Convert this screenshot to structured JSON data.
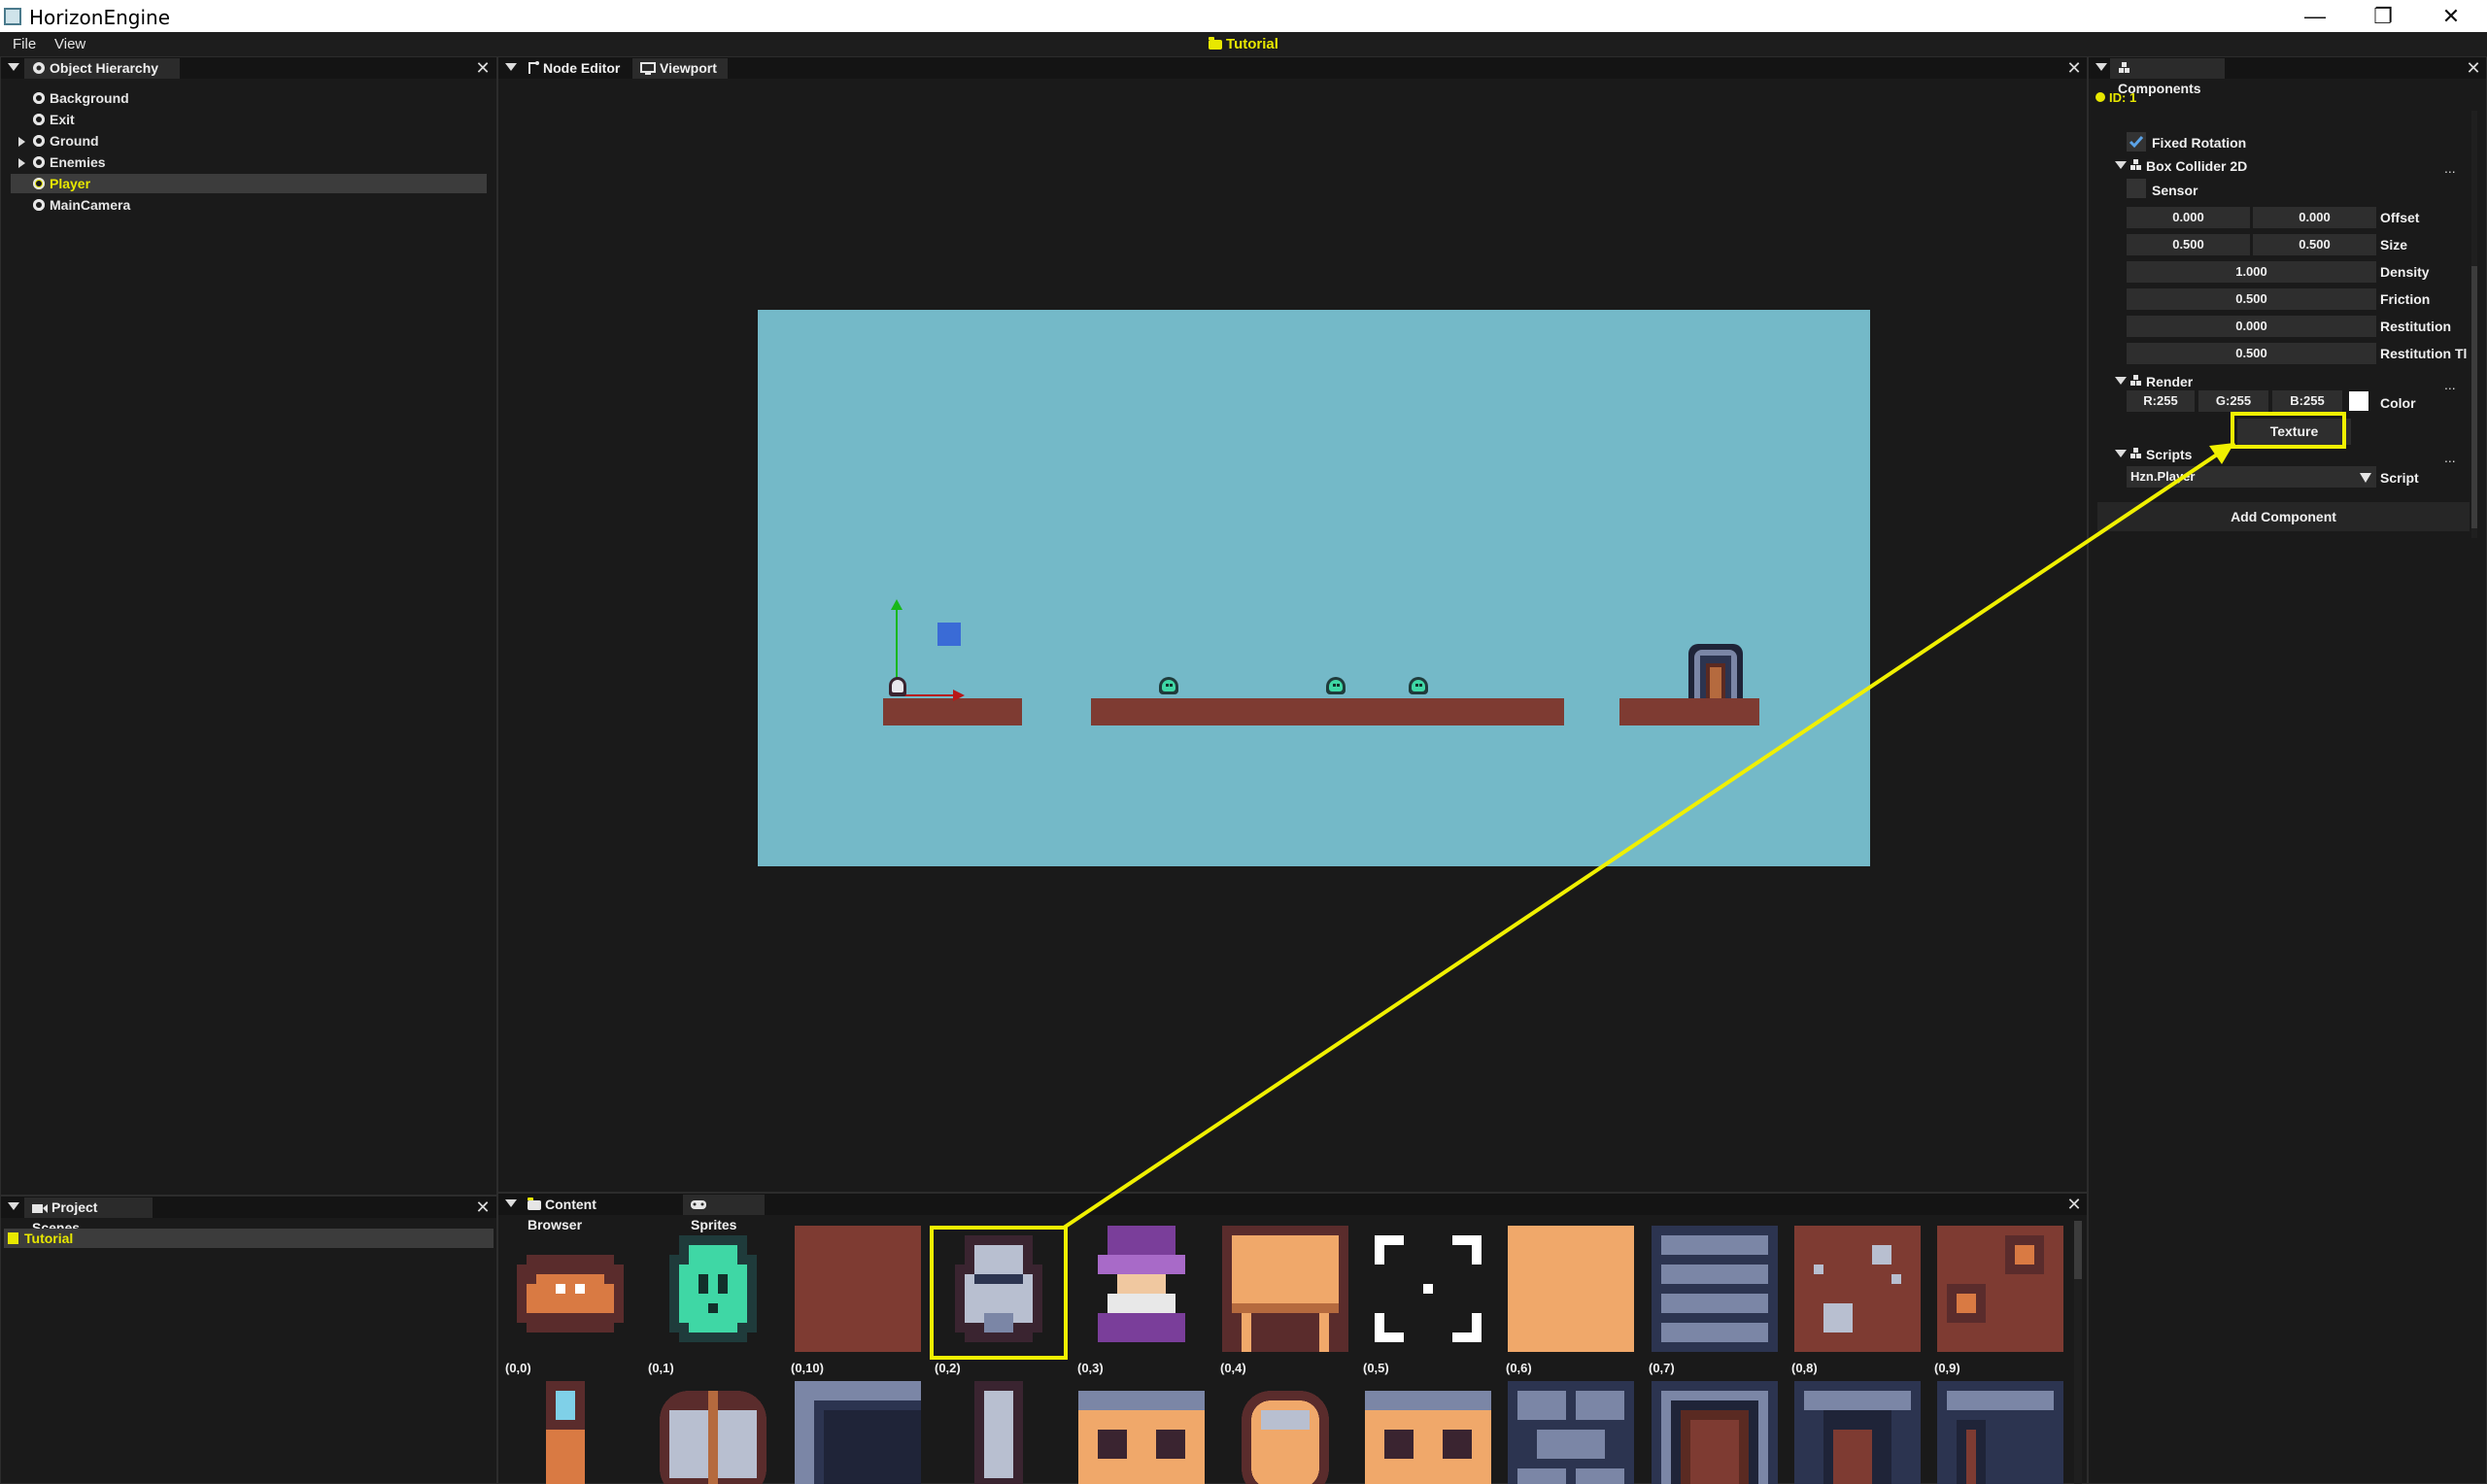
{
  "window": {
    "title": "HorizonEngine",
    "minimize": "—",
    "restore": "❐",
    "close": "✕"
  },
  "menubar": {
    "items": [
      "File",
      "View"
    ],
    "scene_title": "Tutorial"
  },
  "hierarchy": {
    "tab_label": "Object Hierarchy",
    "items": [
      {
        "label": "Background",
        "expandable": false,
        "selected": false
      },
      {
        "label": "Exit",
        "expandable": false,
        "selected": false
      },
      {
        "label": "Ground",
        "expandable": true,
        "selected": false
      },
      {
        "label": "Enemies",
        "expandable": true,
        "selected": false
      },
      {
        "label": "Player",
        "expandable": false,
        "selected": true
      },
      {
        "label": "MainCamera",
        "expandable": false,
        "selected": false
      }
    ]
  },
  "scenes": {
    "tab_label": "Project Scenes",
    "items": [
      "Tutorial"
    ]
  },
  "center": {
    "tabs": [
      "Node Editor",
      "Viewport"
    ]
  },
  "components": {
    "tab_label": "Components",
    "id_label": "ID: 1",
    "fixed_rotation": "Fixed Rotation",
    "box_collider": {
      "title": "Box Collider 2D",
      "sensor": "Sensor",
      "offset": [
        "0.000",
        "0.000"
      ],
      "offset_label": "Offset",
      "size": [
        "0.500",
        "0.500"
      ],
      "size_label": "Size",
      "density": "1.000",
      "density_label": "Density",
      "friction": "0.500",
      "friction_label": "Friction",
      "restitution": "0.000",
      "restitution_label": "Restitution",
      "restitution_th": "0.500",
      "restitution_th_label": "Restitution Tl"
    },
    "render": {
      "title": "Render",
      "r": "R:255",
      "g": "G:255",
      "b": "B:255",
      "color_label": "Color",
      "texture_button": "Texture"
    },
    "scripts": {
      "title": "Scripts",
      "selected": "Hzn.Player",
      "script_label": "Script"
    },
    "more": "...",
    "add_component": "Add Component"
  },
  "content_browser": {
    "tabs": [
      "Content Browser",
      "Sprites"
    ],
    "row1_labels": [
      "(0,0)",
      "(0,1)",
      "(0,10)",
      "(0,2)",
      "(0,3)",
      "(0,4)",
      "(0,5)",
      "(0,6)",
      "(0,7)",
      "(0,8)",
      "(0,9)"
    ]
  },
  "colors": {
    "accent": "#e8e800",
    "sky": "#74b9c8",
    "ground": "#7e3b32",
    "annotation": "#f0f000"
  }
}
